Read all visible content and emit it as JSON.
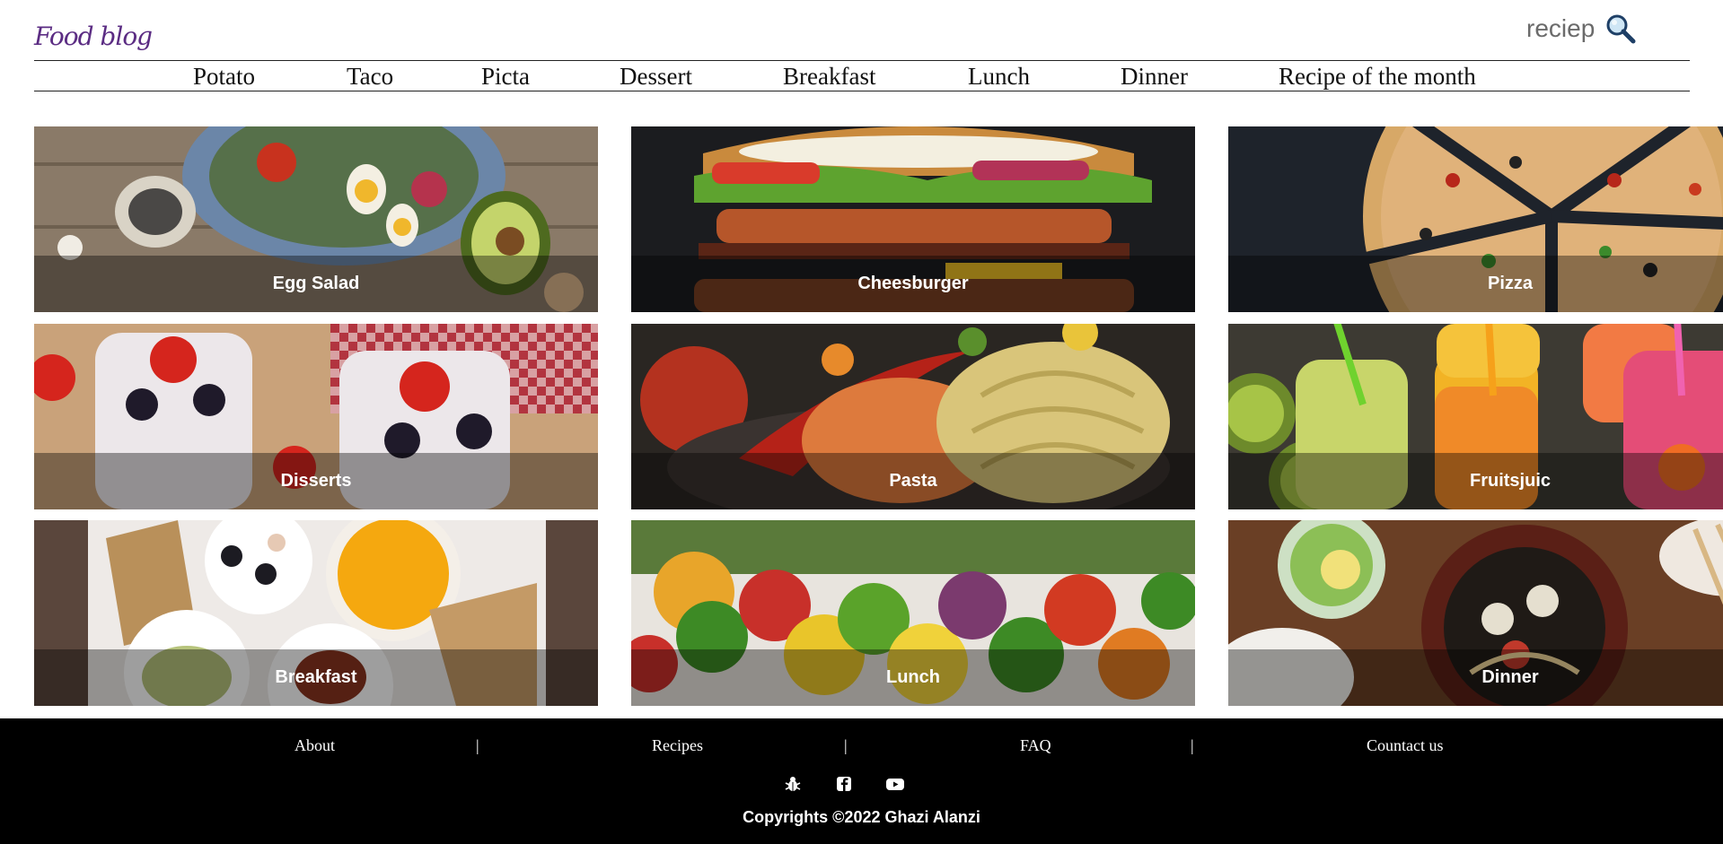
{
  "header": {
    "logo": "Food blog",
    "search_text": "reciep",
    "search_icon": "magnifier-icon"
  },
  "nav": {
    "items": [
      "Potato",
      "Taco",
      "Picta",
      "Dessert",
      "Breakfast",
      "Lunch",
      "Dinner",
      "Recipe of the month"
    ]
  },
  "tiles": [
    {
      "label": "Egg Salad"
    },
    {
      "label": "Cheesburger"
    },
    {
      "label": "Pizza"
    },
    {
      "label": "Disserts"
    },
    {
      "label": "Pasta"
    },
    {
      "label": "Fruitsjuic"
    },
    {
      "label": "Breakfast"
    },
    {
      "label": "Lunch"
    },
    {
      "label": "Dinner"
    }
  ],
  "footer": {
    "links": [
      "About",
      "Recipes",
      "FAQ",
      "Countact us"
    ],
    "separator": "|",
    "social_icons": [
      "bug-icon",
      "facebook-icon",
      "youtube-icon"
    ],
    "copyright": "Copyrights ©2022 Ghazi Alanzi"
  },
  "colors": {
    "logo": "#5b2c83",
    "footer_bg": "#000000",
    "label_overlay": "rgba(0,0,0,0.38)"
  }
}
